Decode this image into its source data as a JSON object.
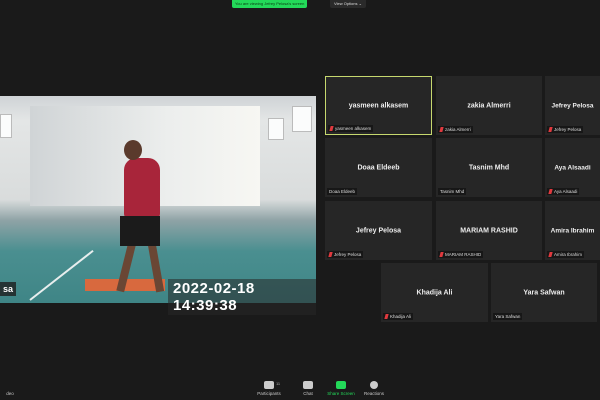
{
  "banner": {
    "text": "You are viewing Jefrey Pelosa's screen",
    "view_options": "View Options ⌄"
  },
  "video": {
    "timestamp": "2022-02-18  14:39:38",
    "name_tag": "sa"
  },
  "participants": [
    {
      "display": "yasmeen alkasem",
      "label": "yasmeen alkasem",
      "muted": true,
      "active": true
    },
    {
      "display": "zakia Almerri",
      "label": "zakia Almerri",
      "muted": true
    },
    {
      "display": "Jefrey Pelosa",
      "label": "Jefrey Pelosa",
      "muted": true
    },
    {
      "display": "Doaa Eldeeb",
      "label": "Doaa Eldeeb",
      "muted": false
    },
    {
      "display": "Tasnim Mhd",
      "label": "Tasnim Mhd",
      "muted": false
    },
    {
      "display": "Aya Alsaadi",
      "label": "Aya Alsaadi",
      "muted": true
    },
    {
      "display": "Jefrey Pelosa",
      "label": "Jefrey Pelosa",
      "muted": true
    },
    {
      "display": "MARIAM RASHID",
      "label": "MARIAM RASHID",
      "muted": true
    },
    {
      "display": "Amira Ibrahim",
      "label": "Amira Ibrahim",
      "muted": true
    },
    {
      "display": "Khadija Ali",
      "label": "Khadija Ali",
      "muted": true
    },
    {
      "display": "Yara Safwan",
      "label": "Yara Safwan",
      "muted": false
    }
  ],
  "toolbar": {
    "video_label": "deo",
    "participants": "Participants",
    "participants_count": "11",
    "chat": "Chat",
    "share": "Share Screen",
    "reactions": "Reactions"
  }
}
